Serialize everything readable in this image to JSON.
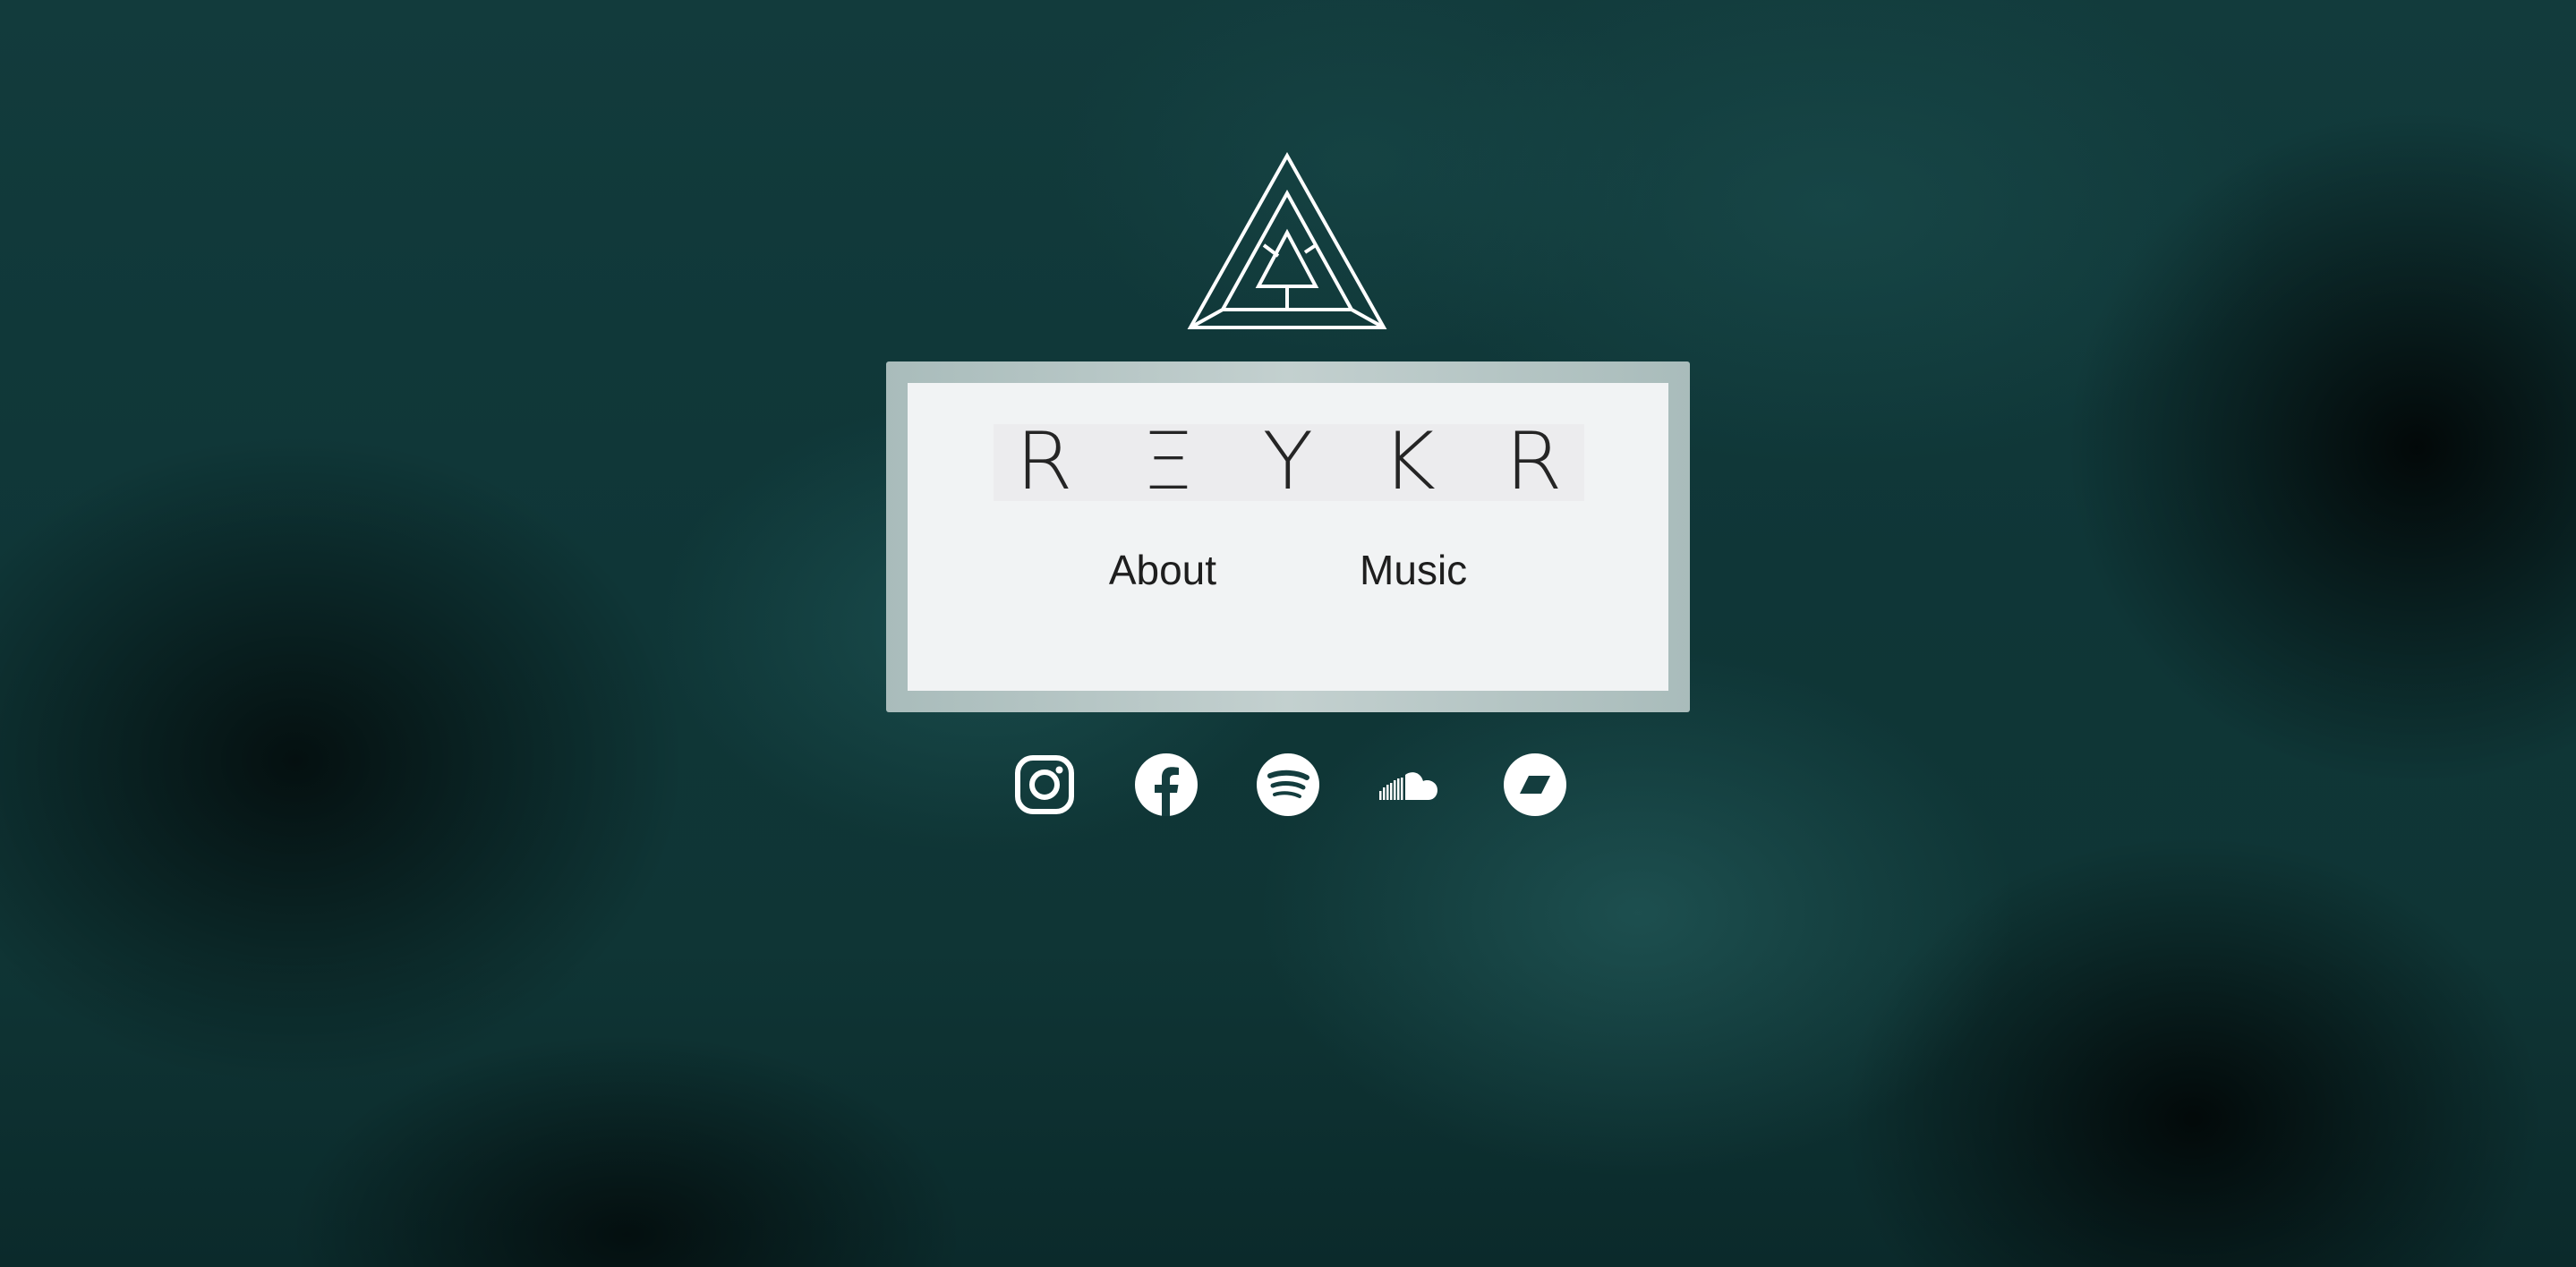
{
  "brand": {
    "wordmark_letters": [
      "R",
      "E",
      "Y",
      "K",
      "R"
    ],
    "logo_icon": "triangle-maze-logo-icon"
  },
  "nav": {
    "about_label": "About",
    "music_label": "Music"
  },
  "social": [
    {
      "icon": "instagram-icon"
    },
    {
      "icon": "facebook-icon"
    },
    {
      "icon": "spotify-icon"
    },
    {
      "icon": "soundcloud-icon"
    },
    {
      "icon": "bandcamp-icon"
    }
  ],
  "colors": {
    "background": "#123b3c",
    "panel_frame": "#b8c8c7",
    "panel_fill": "#f1f3f4",
    "text": "#1e1e1e",
    "icon": "#ffffff"
  }
}
